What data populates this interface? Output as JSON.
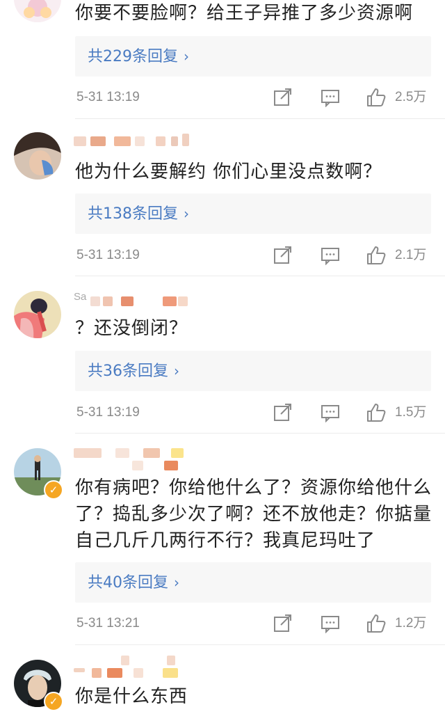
{
  "comments": [
    {
      "text": "你要不要脸啊？给王子异推了多少资源啊",
      "replies": "共229条回复",
      "time": "5-31 13:19",
      "likes": "2.5万"
    },
    {
      "text": "他为什么要解约 你们心里没点数啊？",
      "replies": "共138条回复",
      "time": "5-31 13:19",
      "likes": "2.1万"
    },
    {
      "username_fragment": "Sa",
      "text": "？还没倒闭？",
      "replies": "共36条回复",
      "time": "5-31 13:19",
      "likes": "1.5万"
    },
    {
      "text_lines": [
        "你有病吧？你给他什么了？资源你给他什么",
        "了？捣乱多少次了啊？还不放他走？你掂量",
        "自己几斤几两行不行？我真尼玛吐了"
      ],
      "replies": "共40条回复",
      "time": "5-31 13:21",
      "likes": "1.2万"
    },
    {
      "text": "你是什么东西"
    }
  ],
  "icons": {
    "share": "share-icon",
    "comment": "comment-icon",
    "like": "thumbs-up-icon",
    "verified": "verified-badge-icon"
  },
  "colors": {
    "link": "#4a7bc2",
    "meta": "#8a8a8a",
    "reply_bg": "#f7f7f7",
    "verified": "#f5a623"
  }
}
